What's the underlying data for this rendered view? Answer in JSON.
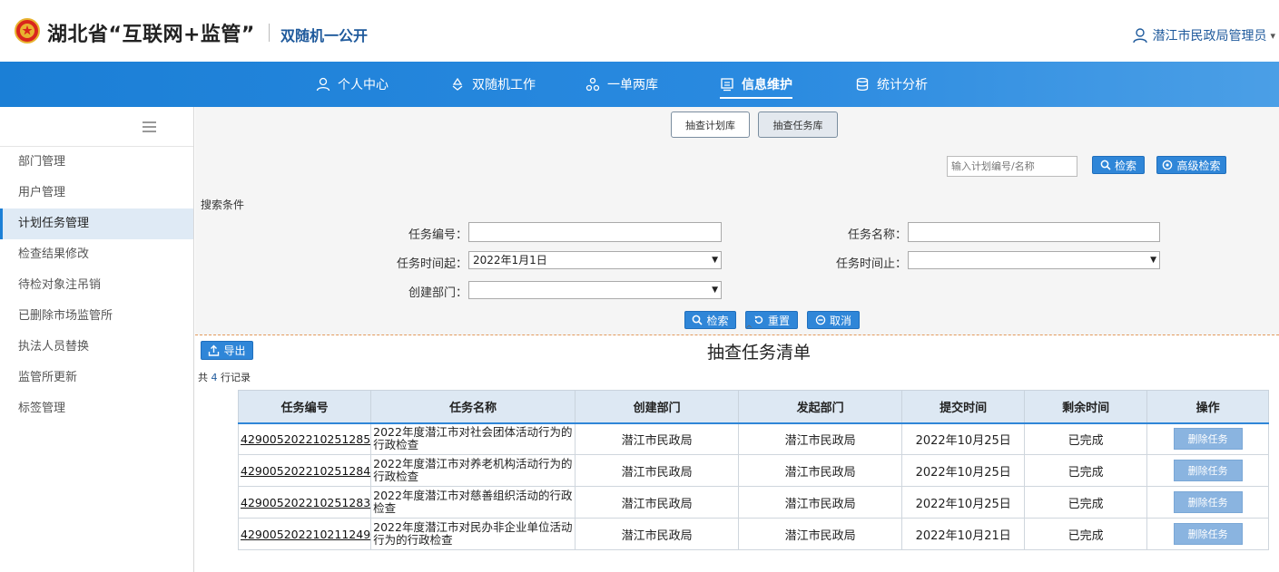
{
  "header": {
    "site_title": "湖北省“互联网+监管”",
    "site_subtitle": "双随机一公开",
    "user_label": "潜江市民政局管理员",
    "user_caret": "▾"
  },
  "nav": {
    "items": [
      {
        "label": "个人中心",
        "icon": "user-icon"
      },
      {
        "label": "双随机工作",
        "icon": "recycle-icon"
      },
      {
        "label": "一单两库",
        "icon": "nodes-icon"
      },
      {
        "label": "信息维护",
        "icon": "document-icon",
        "active": true
      },
      {
        "label": "统计分析",
        "icon": "database-icon"
      }
    ]
  },
  "sidebar": {
    "items": [
      {
        "label": "部门管理"
      },
      {
        "label": "用户管理"
      },
      {
        "label": "计划任务管理",
        "active": true
      },
      {
        "label": "检查结果修改"
      },
      {
        "label": "待检对象注吊销"
      },
      {
        "label": "已删除市场监管所"
      },
      {
        "label": "执法人员替换"
      },
      {
        "label": "监管所更新"
      },
      {
        "label": "标签管理"
      }
    ]
  },
  "tabs": {
    "plan_library": "抽查计划库",
    "task_library": "抽查任务库"
  },
  "quick_search": {
    "placeholder": "输入计划编号/名称",
    "search_label": "检索",
    "advanced_label": "高级检索"
  },
  "search_form": {
    "section_label": "搜索条件",
    "task_code_label": "任务编号：",
    "task_code_value": "",
    "task_name_label": "任务名称：",
    "task_name_value": "",
    "start_time_label": "任务时间起：",
    "start_time_value": "2022年1月1日",
    "end_time_label": "任务时间止：",
    "end_time_value": "",
    "dept_label": "创建部门：",
    "dept_value": "",
    "search_btn": "检索",
    "reset_btn": "重置",
    "cancel_btn": "取消"
  },
  "list": {
    "export_label": "导出",
    "title": "抽查任务清单",
    "count_prefix": "共",
    "count": "4",
    "count_suffix": "行记录",
    "columns": [
      "任务编号",
      "任务名称",
      "创建部门",
      "发起部门",
      "提交时间",
      "剩余时间",
      "操作"
    ],
    "rows": [
      {
        "code": "429005202210251285",
        "name": "2022年度潜江市对社会团体活动行为的行政检查",
        "create_dept": "潜江市民政局",
        "launch_dept": "潜江市民政局",
        "submit_time": "2022年10月25日",
        "remaining": "已完成",
        "action": "删除任务"
      },
      {
        "code": "429005202210251284",
        "name": "2022年度潜江市对养老机构活动行为的行政检查",
        "create_dept": "潜江市民政局",
        "launch_dept": "潜江市民政局",
        "submit_time": "2022年10月25日",
        "remaining": "已完成",
        "action": "删除任务"
      },
      {
        "code": "429005202210251283",
        "name": "2022年度潜江市对慈善组织活动的行政检查",
        "create_dept": "潜江市民政局",
        "launch_dept": "潜江市民政局",
        "submit_time": "2022年10月25日",
        "remaining": "已完成",
        "action": "删除任务"
      },
      {
        "code": "429005202210211249",
        "name": "2022年度潜江市对民办非企业单位活动行为的行政检查",
        "create_dept": "潜江市民政局",
        "launch_dept": "潜江市民政局",
        "submit_time": "2022年10月21日",
        "remaining": "已完成",
        "action": "删除任务"
      }
    ]
  },
  "colors": {
    "nav_blue": "#1b7fd6",
    "button_blue": "#2f86d8",
    "subtitle_blue": "#1f5a9c"
  }
}
